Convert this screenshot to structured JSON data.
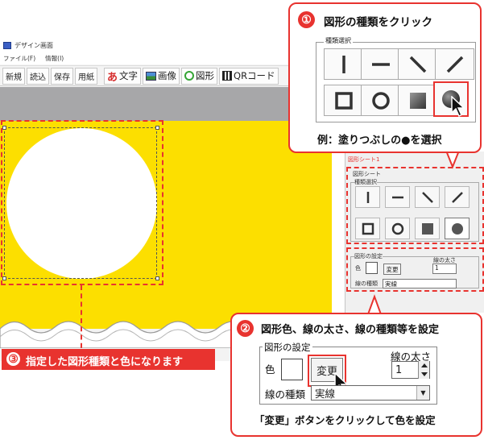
{
  "app": {
    "title": "デザイン画面",
    "menu": [
      "ファイル(F)",
      "情報(I)"
    ],
    "toolbar": {
      "new": "新規",
      "open": "読込",
      "save": "保存",
      "paper": "用紙",
      "text": "文字",
      "text_icon": "あ",
      "image": "画像",
      "shape": "図形",
      "qr": "QRコード"
    }
  },
  "panel": {
    "tab": "図形シート1",
    "sheet_label": "図形シート",
    "type_group": "種類選択",
    "settings_group": "図形の設定",
    "color_label": "色",
    "change_button": "変更",
    "width_label": "線の太さ",
    "width_value": "1",
    "line_type_label": "線の種類",
    "line_type_value": "実線"
  },
  "callout1": {
    "number": "①",
    "title": "図形の種類をクリック",
    "group_label": "種類選択",
    "caption": "例：塗りつぶしの●を選択"
  },
  "callout2": {
    "number": "②",
    "title": "図形色、線の太さ、線の種類等を設定",
    "group_label": "図形の設定",
    "color_label": "色",
    "change_button": "変更",
    "width_label": "線の太さ",
    "width_value": "1",
    "line_type_label": "線の種類",
    "line_type_value": "実線",
    "caption": "「変更」ボタンをクリックして色を設定"
  },
  "callout3": {
    "number": "③",
    "text": "指定した図形種類と色になります"
  },
  "colors": {
    "accent": "#e8332f",
    "canvas": "#fcdf00",
    "shape_fill": "#ffffff"
  },
  "shape_types": [
    "vertical-line-icon",
    "horizontal-line-icon",
    "diagonal-down-icon",
    "diagonal-up-icon",
    "square-outline-icon",
    "circle-outline-icon",
    "square-filled-icon",
    "circle-filled-icon"
  ]
}
